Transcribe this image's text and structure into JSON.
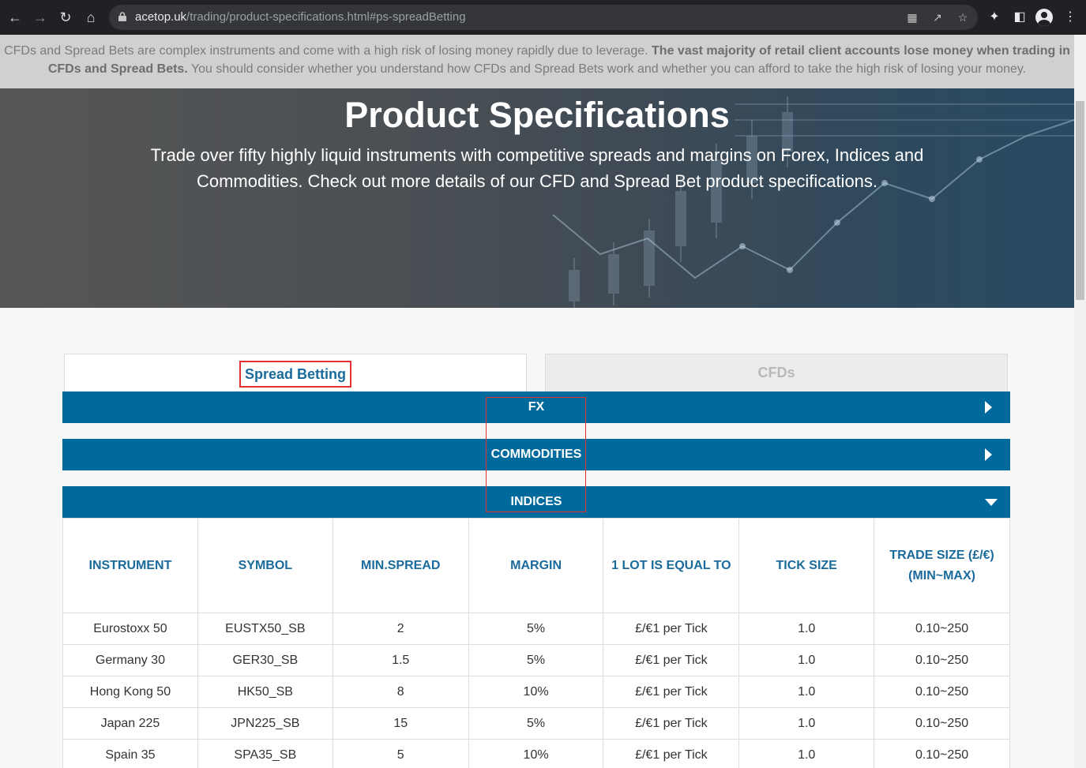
{
  "browser": {
    "url_host": "acetop.uk",
    "url_path": "/trading/product-specifications.html#ps-spreadBetting"
  },
  "risk_warning": {
    "part1": "CFDs and Spread Bets are complex instruments and come with a high risk of losing money rapidly due to leverage. ",
    "bold": "The vast majority of retail client accounts lose money when trading in CFDs and Spread Bets.",
    "part2": " You should consider whether you understand how CFDs and Spread Bets work and whether you can afford to take the high risk of losing your money."
  },
  "hero": {
    "title": "Product Specifications",
    "subtitle": "Trade over fifty highly liquid instruments with competitive spreads and margins on Forex, Indices and Commodities. Check out more details of our CFD and Spread Bet product specifications."
  },
  "tabs": {
    "spread_betting": "Spread Betting",
    "cfds": "CFDs"
  },
  "sections": {
    "fx": "FX",
    "commodities": "COMMODITIES",
    "indices": "INDICES"
  },
  "table": {
    "headers": [
      "INSTRUMENT",
      "SYMBOL",
      "MIN.SPREAD",
      "MARGIN",
      "1 LOT IS EQUAL TO",
      "TICK SIZE",
      "TRADE SIZE (£/€) (MIN~MAX)"
    ],
    "rows": [
      [
        "Eurostoxx 50",
        "EUSTX50_SB",
        "2",
        "5%",
        "£/€1 per Tick",
        "1.0",
        "0.10~250"
      ],
      [
        "Germany 30",
        "GER30_SB",
        "1.5",
        "5%",
        "£/€1 per Tick",
        "1.0",
        "0.10~250"
      ],
      [
        "Hong Kong 50",
        "HK50_SB",
        "8",
        "10%",
        "£/€1 per Tick",
        "1.0",
        "0.10~250"
      ],
      [
        "Japan 225",
        "JPN225_SB",
        "15",
        "5%",
        "£/€1 per Tick",
        "1.0",
        "0.10~250"
      ],
      [
        "Spain 35",
        "SPA35_SB",
        "5",
        "10%",
        "£/€1 per Tick",
        "1.0",
        "0.10~250"
      ]
    ]
  },
  "colors": {
    "accent": "#016a9c",
    "header_text": "#1a6b9b",
    "highlight": "#e03030"
  }
}
